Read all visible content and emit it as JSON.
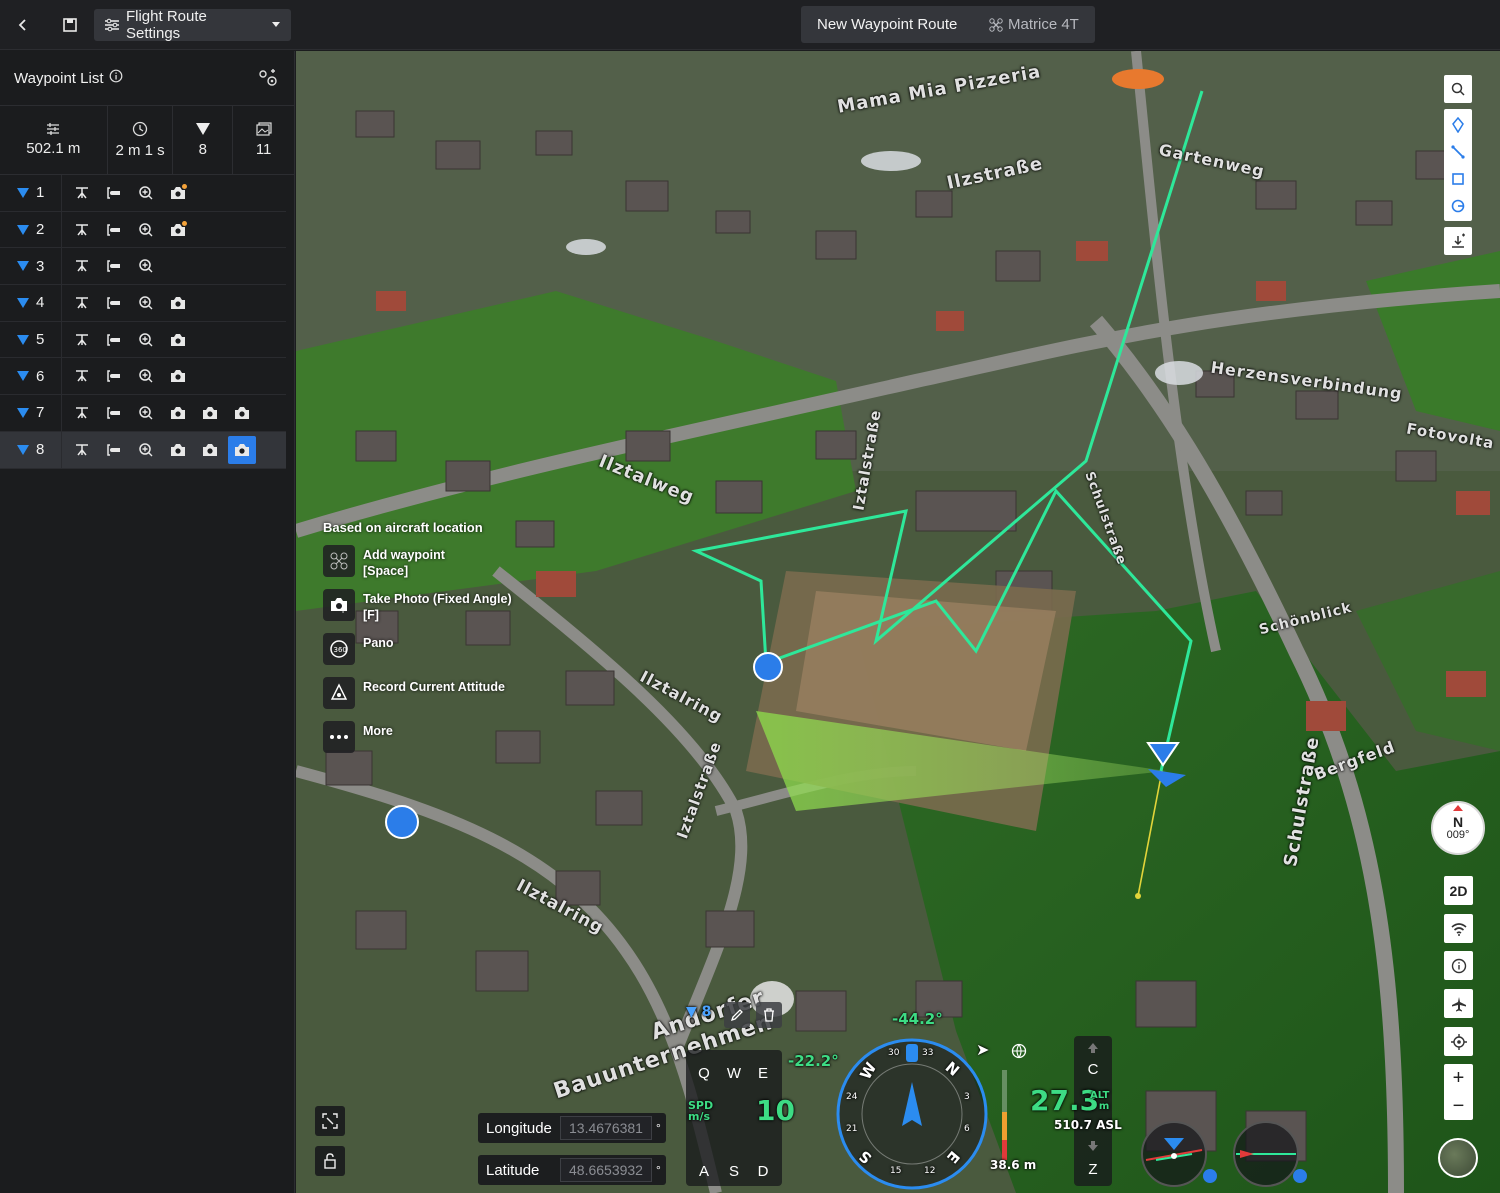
{
  "topbar": {
    "settings_label": "Flight Route Settings",
    "route_name": "New Waypoint Route",
    "drone_name": "Matrice 4T"
  },
  "sidebar": {
    "title": "Waypoint List",
    "stats": {
      "distance": "502.1 m",
      "duration": "2 m 1 s",
      "waypoints": "8",
      "photos": "11"
    },
    "waypoints": [
      {
        "num": "1",
        "actions": [
          "hover",
          "gimbal",
          "zoom",
          "photo-dot"
        ]
      },
      {
        "num": "2",
        "actions": [
          "hover",
          "gimbal",
          "zoom",
          "photo-dot"
        ]
      },
      {
        "num": "3",
        "actions": [
          "hover",
          "gimbal",
          "zoom"
        ]
      },
      {
        "num": "4",
        "actions": [
          "hover",
          "gimbal",
          "zoom",
          "photo"
        ]
      },
      {
        "num": "5",
        "actions": [
          "hover",
          "gimbal",
          "zoom",
          "photo"
        ]
      },
      {
        "num": "6",
        "actions": [
          "hover",
          "gimbal",
          "zoom",
          "photo"
        ]
      },
      {
        "num": "7",
        "actions": [
          "hover",
          "gimbal",
          "zoom",
          "photo",
          "photo",
          "photo"
        ]
      },
      {
        "num": "8",
        "actions": [
          "hover",
          "gimbal",
          "zoom",
          "photo",
          "photo",
          "photo-active"
        ],
        "selected": true
      }
    ]
  },
  "map": {
    "streets": [
      "Mama Mia Pizzeria",
      "Gartenweg",
      "Ilzstraße",
      "Herzensverbindung",
      "Ilztalweg",
      "Iztalstraße",
      "Schönblick",
      "Ilztalring",
      "Bergfeld",
      "Schulstraße",
      "Ilztalring",
      "Iztalstraße",
      "Andorfer Bauunternehmen",
      "Fotovolta",
      "Schulstraße"
    ],
    "street_short": "Schulstraße"
  },
  "context_menu": {
    "header": "Based on aircraft location",
    "items": [
      {
        "label": "Add waypoint",
        "sub": "[Space]",
        "icon": "add-waypoint-icon"
      },
      {
        "label": "Take Photo (Fixed Angle)",
        "sub": "[F]",
        "icon": "camera-icon"
      },
      {
        "label": "Pano",
        "sub": "",
        "icon": "pano-icon"
      },
      {
        "label": "Record Current Attitude",
        "sub": "",
        "icon": "attitude-icon"
      },
      {
        "label": "More",
        "sub": "",
        "icon": "more-icon"
      }
    ]
  },
  "right_tools": {
    "view_mode": "2D",
    "compass_letter": "N",
    "compass_heading": "009°"
  },
  "coords": {
    "longitude_label": "Longitude",
    "longitude_value": "13.4676381",
    "latitude_label": "Latitude",
    "latitude_value": "48.6653932",
    "unit": "°"
  },
  "keys": {
    "q": "Q",
    "w": "W",
    "e": "E",
    "a": "A",
    "s": "S",
    "d": "D",
    "c": "C",
    "z": "Z"
  },
  "hud": {
    "waypoint_marker": "8",
    "gimbal_pitch": "-44.2°",
    "left_pitch": "-22.2°",
    "speed_label": "SPD",
    "speed_unit": "m/s",
    "speed_value": "10",
    "altitude_value": "27.3",
    "alt_label": "ALT",
    "alt_unit": "m",
    "asl": "510.7 ASL",
    "height_below": "38.6 m",
    "compass_labels": [
      "W",
      "N",
      "E",
      "S"
    ],
    "compass_ticks": [
      "30",
      "33",
      "3",
      "6",
      "12",
      "15",
      "21",
      "24"
    ]
  }
}
